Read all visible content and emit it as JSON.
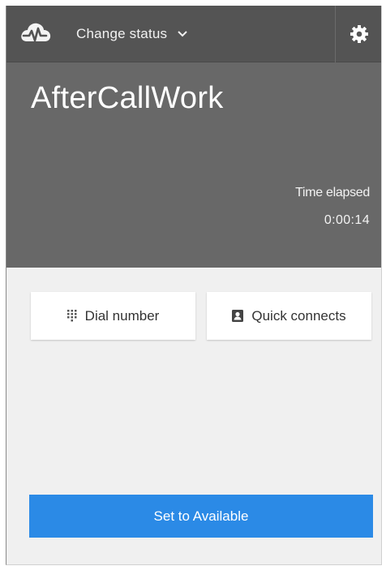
{
  "header": {
    "status_toggle_label": "Change status",
    "logo_icon": "cloud-pulse-icon",
    "chevron_icon": "chevron-down-icon",
    "settings_icon": "gear-icon"
  },
  "agent_state": {
    "name": "AfterCallWork",
    "elapsed_label": "Time elapsed",
    "elapsed_value": "0:00:14"
  },
  "actions": {
    "dial_number_label": "Dial number",
    "dial_number_icon": "dialpad-icon",
    "quick_connects_label": "Quick connects",
    "quick_connects_icon": "contact-book-icon"
  },
  "primary_action": {
    "label": "Set to Available",
    "color": "#2b8ae6"
  },
  "colors": {
    "topbar": "#545454",
    "state_panel": "#686868",
    "body": "#f0f0f0"
  }
}
